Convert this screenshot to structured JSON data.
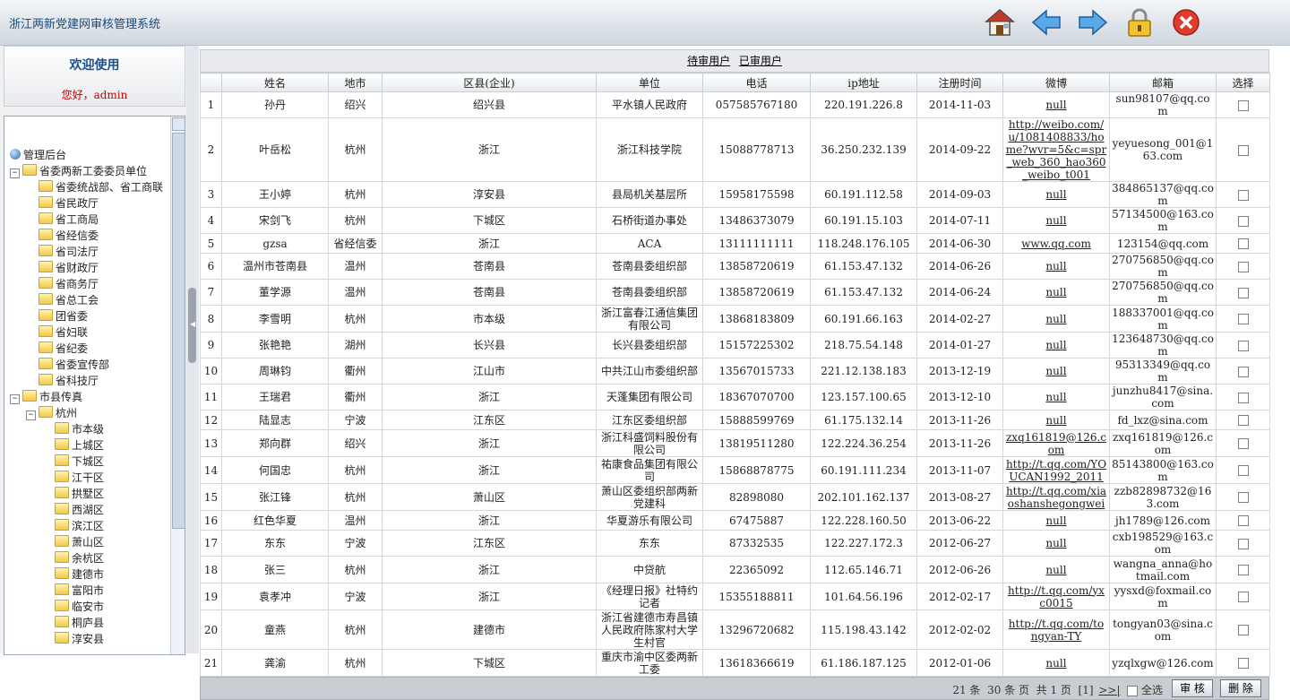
{
  "app": {
    "title": "浙江两新党建网审核管理系统"
  },
  "toolbar": {
    "home_icon": "home-icon",
    "back_icon": "arrow-left-icon",
    "forward_icon": "arrow-right-icon",
    "lock_icon": "lock-icon",
    "close_icon": "close-icon"
  },
  "sidebar": {
    "welcome": "欢迎使用",
    "greeting": "您好，admin",
    "tree": [
      {
        "label": "管理后台",
        "level": 0,
        "kind": "root"
      },
      {
        "label": "省委两新工委委员单位",
        "level": 1,
        "kind": "group"
      },
      {
        "label": "省委统战部、省工商联",
        "level": 2,
        "kind": "leaf"
      },
      {
        "label": "省民政厅",
        "level": 2,
        "kind": "leaf"
      },
      {
        "label": "省工商局",
        "level": 2,
        "kind": "leaf"
      },
      {
        "label": "省经信委",
        "level": 2,
        "kind": "leaf"
      },
      {
        "label": "省司法厅",
        "level": 2,
        "kind": "leaf"
      },
      {
        "label": "省财政厅",
        "level": 2,
        "kind": "leaf"
      },
      {
        "label": "省商务厅",
        "level": 2,
        "kind": "leaf"
      },
      {
        "label": "省总工会",
        "level": 2,
        "kind": "leaf"
      },
      {
        "label": "团省委",
        "level": 2,
        "kind": "leaf"
      },
      {
        "label": "省妇联",
        "level": 2,
        "kind": "leaf"
      },
      {
        "label": "省纪委",
        "level": 2,
        "kind": "leaf"
      },
      {
        "label": "省委宣传部",
        "level": 2,
        "kind": "leaf"
      },
      {
        "label": "省科技厅",
        "level": 2,
        "kind": "leaf"
      },
      {
        "label": "市县传真",
        "level": 1,
        "kind": "group"
      },
      {
        "label": "杭州",
        "level": 2,
        "kind": "group"
      },
      {
        "label": "市本级",
        "level": 3,
        "kind": "leaf"
      },
      {
        "label": "上城区",
        "level": 3,
        "kind": "leaf"
      },
      {
        "label": "下城区",
        "level": 3,
        "kind": "leaf"
      },
      {
        "label": "江干区",
        "level": 3,
        "kind": "leaf"
      },
      {
        "label": "拱墅区",
        "level": 3,
        "kind": "leaf"
      },
      {
        "label": "西湖区",
        "level": 3,
        "kind": "leaf"
      },
      {
        "label": "滨江区",
        "level": 3,
        "kind": "leaf"
      },
      {
        "label": "萧山区",
        "level": 3,
        "kind": "leaf"
      },
      {
        "label": "余杭区",
        "level": 3,
        "kind": "leaf"
      },
      {
        "label": "建德市",
        "level": 3,
        "kind": "leaf"
      },
      {
        "label": "富阳市",
        "level": 3,
        "kind": "leaf"
      },
      {
        "label": "临安市",
        "level": 3,
        "kind": "leaf"
      },
      {
        "label": "桐庐县",
        "level": 3,
        "kind": "leaf"
      },
      {
        "label": "淳安县",
        "level": 3,
        "kind": "leaf"
      }
    ]
  },
  "tabs": {
    "pending": "待审用户",
    "approved": "已审用户"
  },
  "table": {
    "columns": [
      "",
      "姓名",
      "地市",
      "区县(企业)",
      "单位",
      "电话",
      "ip地址",
      "注册时间",
      "微博",
      "邮箱",
      "选择"
    ],
    "rows": [
      [
        "1",
        "孙丹",
        "绍兴",
        "绍兴县",
        "平水镇人民政府",
        "057585767180",
        "220.191.226.8",
        "2014-11-03",
        "null",
        "sun98107@qq.com"
      ],
      [
        "2",
        "叶岳松",
        "杭州",
        "浙江",
        "浙江科技学院",
        "15088778713",
        "36.250.232.139",
        "2014-09-22",
        "http://weibo.com/u/1081408833/home?wvr=5&c=spr_web_360_hao360_weibo_t001",
        "yeyuesong_001@163.com"
      ],
      [
        "3",
        "王小婷",
        "杭州",
        "淳安县",
        "县局机关基层所",
        "15958175598",
        "60.191.112.58",
        "2014-09-03",
        "null",
        "384865137@qq.com"
      ],
      [
        "4",
        "宋剑飞",
        "杭州",
        "下城区",
        "石桥街道办事处",
        "13486373079",
        "60.191.15.103",
        "2014-07-11",
        "null",
        "57134500@163.com"
      ],
      [
        "5",
        "gzsa",
        "省经信委",
        "浙江",
        "ACA",
        "13111111111",
        "118.248.176.105",
        "2014-06-30",
        "www.qq.com",
        "123154@qq.com"
      ],
      [
        "6",
        "温州市苍南县",
        "温州",
        "苍南县",
        "苍南县委组织部",
        "13858720619",
        "61.153.47.132",
        "2014-06-26",
        "null",
        "270756850@qq.com"
      ],
      [
        "7",
        "董学源",
        "温州",
        "苍南县",
        "苍南县委组织部",
        "13858720619",
        "61.153.47.132",
        "2014-06-24",
        "null",
        "270756850@qq.com"
      ],
      [
        "8",
        "李雪明",
        "杭州",
        "市本级",
        "浙江富春江通信集团有限公司",
        "13868183809",
        "60.191.66.163",
        "2014-02-27",
        "null",
        "188337001@qq.com"
      ],
      [
        "9",
        "张艳艳",
        "湖州",
        "长兴县",
        "长兴县委组织部",
        "15157225302",
        "218.75.54.148",
        "2014-01-27",
        "null",
        "123648730@qq.com"
      ],
      [
        "10",
        "周琳钧",
        "衢州",
        "江山市",
        "中共江山市委组织部",
        "13567015733",
        "221.12.138.183",
        "2013-12-19",
        "null",
        "95313349@qq.com"
      ],
      [
        "11",
        "王瑞君",
        "衢州",
        "浙江",
        "天蓬集团有限公司",
        "18367070700",
        "123.157.100.65",
        "2013-12-10",
        "null",
        "junzhu8417@sina.com"
      ],
      [
        "12",
        "陆显志",
        "宁波",
        "江东区",
        "江东区委组织部",
        "15888599769",
        "61.175.132.14",
        "2013-11-26",
        "null",
        "fd_lxz@sina.com"
      ],
      [
        "13",
        "郑向群",
        "绍兴",
        "浙江",
        "浙江科盛饲料股份有限公司",
        "13819511280",
        "122.224.36.254",
        "2013-11-26",
        "zxq161819@126.com",
        "zxq161819@126.com"
      ],
      [
        "14",
        "何国忠",
        "杭州",
        "浙江",
        "祐康食品集团有限公司",
        "15868878775",
        "60.191.111.234",
        "2013-11-07",
        "http://t.qq.com/YOUCAN1992_2011",
        "85143800@163.com"
      ],
      [
        "15",
        "张江锋",
        "杭州",
        "萧山区",
        "萧山区委组织部两新党建科",
        "82898080",
        "202.101.162.137",
        "2013-08-27",
        "http://t.qq.com/xiaoshanshegongwei",
        "zzb82898732@163.com"
      ],
      [
        "16",
        "红色华夏",
        "温州",
        "浙江",
        "华夏游乐有限公司",
        "67475887",
        "122.228.160.50",
        "2013-06-22",
        "null",
        "jh1789@126.com"
      ],
      [
        "17",
        "东东",
        "宁波",
        "江东区",
        "东东",
        "87332535",
        "122.227.172.3",
        "2012-06-27",
        "null",
        "cxb198529@163.com"
      ],
      [
        "18",
        "张三",
        "杭州",
        "浙江",
        "中贷航",
        "22365092",
        "112.65.146.71",
        "2012-06-26",
        "null",
        "wangna_anna@hotmail.com"
      ],
      [
        "19",
        "袁孝冲",
        "宁波",
        "浙江",
        "《经理日报》社特约记者",
        "15355188811",
        "101.64.56.196",
        "2012-02-17",
        "http://t.qq.com/yxc0015",
        "yysxd@foxmail.com"
      ],
      [
        "20",
        "童燕",
        "杭州",
        "建德市",
        "浙江省建德市寿昌镇人民政府陈家村大学生村官",
        "13296720682",
        "115.198.43.142",
        "2012-02-02",
        "http://t.qq.com/tongyan-TY",
        "tongyan03@sina.com"
      ],
      [
        "21",
        "龚渝",
        "杭州",
        "下城区",
        "重庆市渝中区委两新工委",
        "13618366619",
        "61.186.187.125",
        "2012-01-06",
        "null",
        "yzqlxgw@126.com"
      ]
    ]
  },
  "footer": {
    "total": "21 条",
    "per_page": "30 条 页",
    "pages": "共 1 页",
    "current": "[1]",
    "next": ">>|",
    "select_all": "全选",
    "approve": "审 核",
    "delete": "删 除"
  },
  "colors": {
    "accent": "#1c4f86",
    "greeting": "#c00000"
  }
}
